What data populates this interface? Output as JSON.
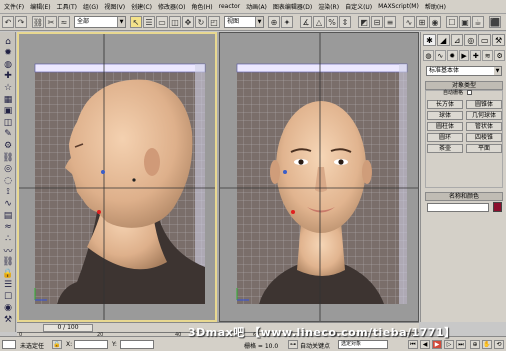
{
  "menubar": [
    "文件(F)",
    "编辑(E)",
    "工具(T)",
    "组(G)",
    "视图(V)",
    "创建(C)",
    "修改器(O)",
    "角色(H)",
    "reactor",
    "动画(A)",
    "图表编辑器(D)",
    "渲染(R)",
    "自定义(U)",
    "MAXScript(M)",
    "帮助(H)"
  ],
  "toolbar": {
    "selection_filter": "全部",
    "ref_coord": "视图",
    "buttons": [
      "undo-icon",
      "redo-icon",
      "link-icon",
      "unlink-icon",
      "bind-icon",
      "select-arrow-icon"
    ]
  },
  "left_toolbar": {
    "icons": [
      "camera-icon",
      "light-icon",
      "sphere-icon",
      "helper-icon",
      "star-icon",
      "grid-icon",
      "box-icon",
      "cylinder-icon",
      "wrench-icon",
      "gear-icon",
      "link-icon",
      "target-icon",
      "tube-icon",
      "bone-icon",
      "spline-icon",
      "cloth-icon",
      "hair-icon",
      "particle-icon",
      "wave-icon",
      "chain-icon",
      "lock-icon",
      "layer-icon",
      "render-icon",
      "material-icon",
      "hammer-icon"
    ]
  },
  "viewports": {
    "left_label": "",
    "right_label": ""
  },
  "command_panel": {
    "tabs": [
      "create",
      "modify",
      "hierarchy",
      "motion",
      "display",
      "utilities"
    ],
    "category_icons": [
      "geometry",
      "shapes",
      "lights",
      "cameras",
      "helpers",
      "spacewarps",
      "systems"
    ],
    "primitive_type": "标准基本体",
    "object_type_header": "对象类型",
    "autogrid_label": "自动栅格",
    "objects": [
      "长方体",
      "圆锥体",
      "球体",
      "几何球体",
      "圆柱体",
      "管状体",
      "圆环",
      "四棱锥",
      "茶壶",
      "平面"
    ],
    "name_color_header": "名称和颜色",
    "object_color": "#8b0f2e"
  },
  "timeline": {
    "frame_indicator": "0 / 100",
    "ticks": [
      "0",
      "20",
      "40",
      "60",
      "80",
      "100"
    ]
  },
  "statusbar": {
    "mode_text": "未选定任",
    "x_label": "X:",
    "y_label": "Y:",
    "grid_text": "栅格 = 10.0",
    "autokey_label": "自动关键点",
    "selected_label": "选定对象",
    "setkey_label": "设置关键点",
    "keyfilter_label": "关键点过滤器..."
  },
  "watermark": "3Dmax吧  【www.lineco.com/tieba/1771】"
}
